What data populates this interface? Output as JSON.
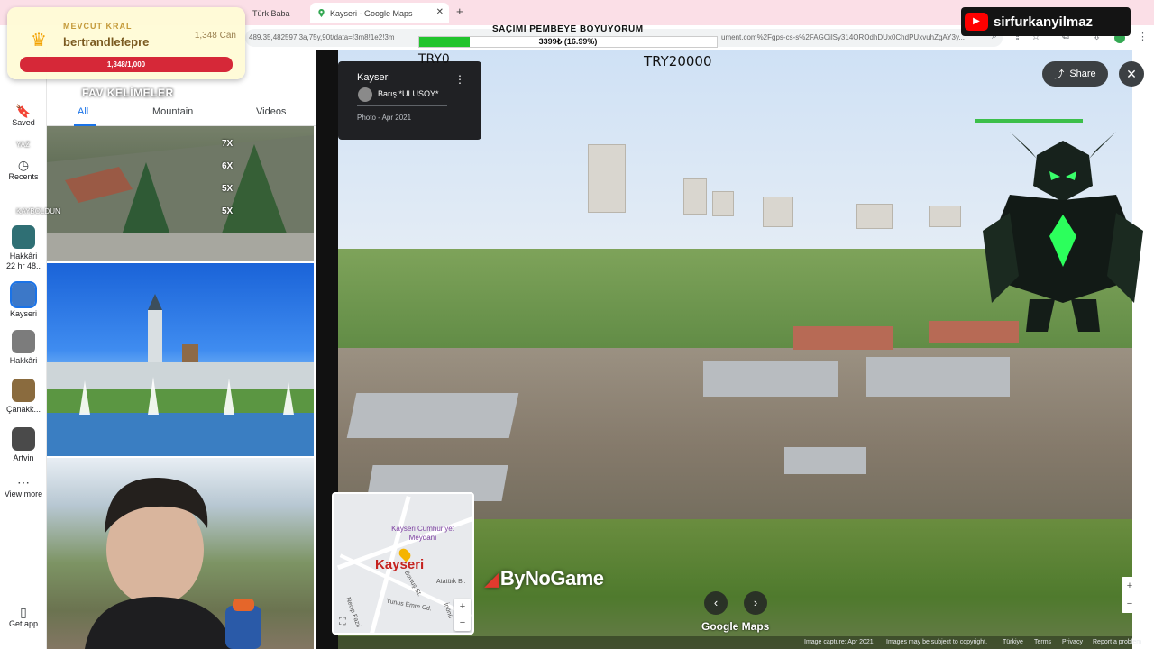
{
  "browser": {
    "tabs": [
      {
        "title": "Türk Baba"
      },
      {
        "title": "Kayseri - Google Maps",
        "active": true
      }
    ],
    "url": "489.35,482597.3a,75y,90t/data=!3m8!1e2!3m",
    "url_tail": "ument.com%2Fgps-cs-s%2FAGOilSy314OROdhDUx0ChdPUxvuhZgAY3y..."
  },
  "maps": {
    "rail": {
      "saved": "Saved",
      "recents": "Recents",
      "recent_places": [
        {
          "label": "Hakkâri",
          "sub": "22 hr 48..",
          "color": "#2f6f74"
        },
        {
          "label": "Kayseri",
          "color": "#3c78c8"
        },
        {
          "label": "Hakkâri",
          "color": "#7c7c7c"
        },
        {
          "label": "Çanakk...",
          "color": "#8a6b3e"
        },
        {
          "label": "Artvin",
          "color": "#4a4a4a"
        }
      ],
      "view_more": "View more",
      "get_app": "Get app"
    },
    "panel_tabs": [
      "All",
      "Mountain",
      "Videos"
    ],
    "active_tab": "All"
  },
  "streetview": {
    "place": "Kayseri",
    "author": "Barış *ULUSOY*",
    "date": "Photo - Apr 2021",
    "share_label": "Share",
    "minimap": {
      "city": "Kayseri",
      "poi": "Kayseri Cumhuriyet Meydanı",
      "streets": [
        "Atatürk Bl.",
        "Yunus Emre Cd.",
        "Necip Fazıl",
        "Boyluş St.",
        "İnönü"
      ]
    },
    "logo": "Google Maps",
    "footer": [
      "Image capture: Apr 2021",
      "Images may be subject to copyright.",
      "Türkiye",
      "Terms",
      "Privacy",
      "Report a problem"
    ]
  },
  "overlay": {
    "king": {
      "label": "MEVCUT KRAL",
      "user": "bertrandlefepre",
      "amount": "1,348 Can",
      "progress_text": "1,348/1,000"
    },
    "goal": {
      "title": "SAÇIMI PEMBEYE BOYUYORUM",
      "text": "3399₺ (16.99%)",
      "percent": 16.99,
      "start_label": "TRY0",
      "end_label": "TRY20000"
    },
    "channel": "sirfurkanyilmaz",
    "fav_title": "FAV KELİMELER",
    "combo": [
      "7X",
      "7X",
      "6X",
      "5X",
      "5X"
    ],
    "ghost": [
      "YAZ",
      "KAYBOLDUN"
    ],
    "sponsor": "ByNoGame"
  },
  "colors": {
    "accent": "#1a73e8",
    "goal_fill": "#21c42d",
    "king_bar": "#d62838",
    "tabbar": "#fbdfe7"
  }
}
